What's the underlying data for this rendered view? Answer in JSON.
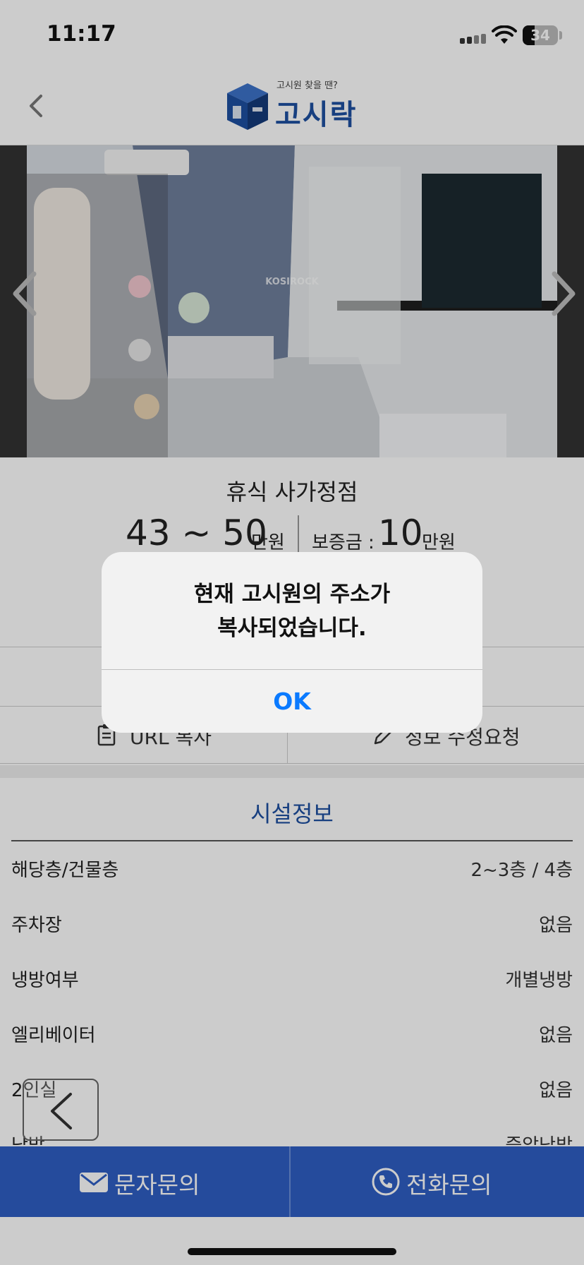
{
  "status_bar": {
    "time": "11:17",
    "battery": "34",
    "battery_fraction": 0.34
  },
  "header": {
    "logo_tagline": "고시원 찾을 땐?",
    "logo_text": "고시락"
  },
  "gallery": {
    "watermark": "KOSIROCK"
  },
  "room": {
    "name": "휴식 사가정점",
    "price_range": "43 ~ 50",
    "price_unit": "만원",
    "deposit_label": "보증금 :",
    "deposit_value": "10",
    "deposit_unit": "만원"
  },
  "actions": {
    "url_copy": "URL 복사",
    "edit_request": "정보 수정요청"
  },
  "facility": {
    "title": "시설정보",
    "rows": [
      {
        "label": "해당층/건물층",
        "value": "2~3층 / 4층"
      },
      {
        "label": "주차장",
        "value": "없음"
      },
      {
        "label": "냉방여부",
        "value": "개별냉방"
      },
      {
        "label": "엘리베이터",
        "value": "없음"
      },
      {
        "label": "2인실",
        "value": "없음"
      },
      {
        "label": "난방",
        "value": "중앙난방"
      }
    ]
  },
  "bottom_bar": {
    "sms_label": "문자문의",
    "call_label": "전화문의"
  },
  "alert": {
    "message_line1": "현재 고시원의 주소가",
    "message_line2": "복사되었습니다.",
    "ok_label": "OK"
  },
  "colors": {
    "brand": "#2f5ec4",
    "accent": "#1d4fa0",
    "ios_blue": "#0a7aff"
  }
}
